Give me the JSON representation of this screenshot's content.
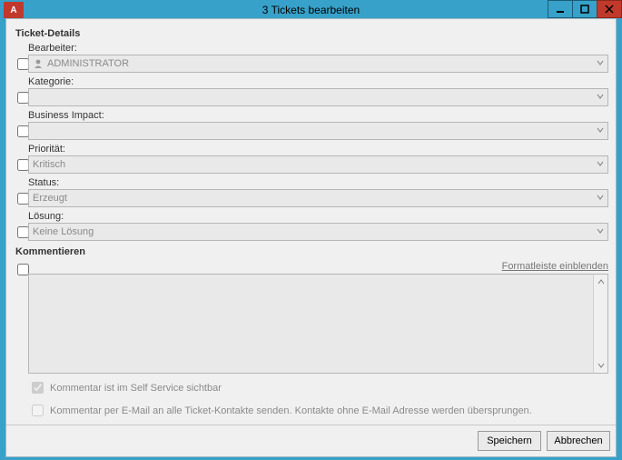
{
  "titlebar": {
    "icon_letter": "A",
    "title": "3 Tickets bearbeiten"
  },
  "section_ticket_details": "Ticket-Details",
  "fields": {
    "bearbeiter": {
      "label": "Bearbeiter:",
      "value": "ADMINISTRATOR"
    },
    "kategorie": {
      "label": "Kategorie:",
      "value": ""
    },
    "impact": {
      "label": "Business Impact:",
      "value": ""
    },
    "prioritaet": {
      "label": "Priorität:",
      "value": "Kritisch"
    },
    "status": {
      "label": "Status:",
      "value": "Erzeugt"
    },
    "loesung": {
      "label": "Lösung:",
      "value": "Keine Lösung"
    }
  },
  "section_kommentieren": "Kommentieren",
  "format_link": "Formatleiste einblenden",
  "checks": {
    "self_service": "Kommentar ist im Self Service sichtbar",
    "email_all": "Kommentar per E-Mail an alle Ticket-Kontakte senden. Kontakte ohne E-Mail Adresse werden übersprungen."
  },
  "buttons": {
    "save": "Speichern",
    "cancel": "Abbrechen"
  }
}
